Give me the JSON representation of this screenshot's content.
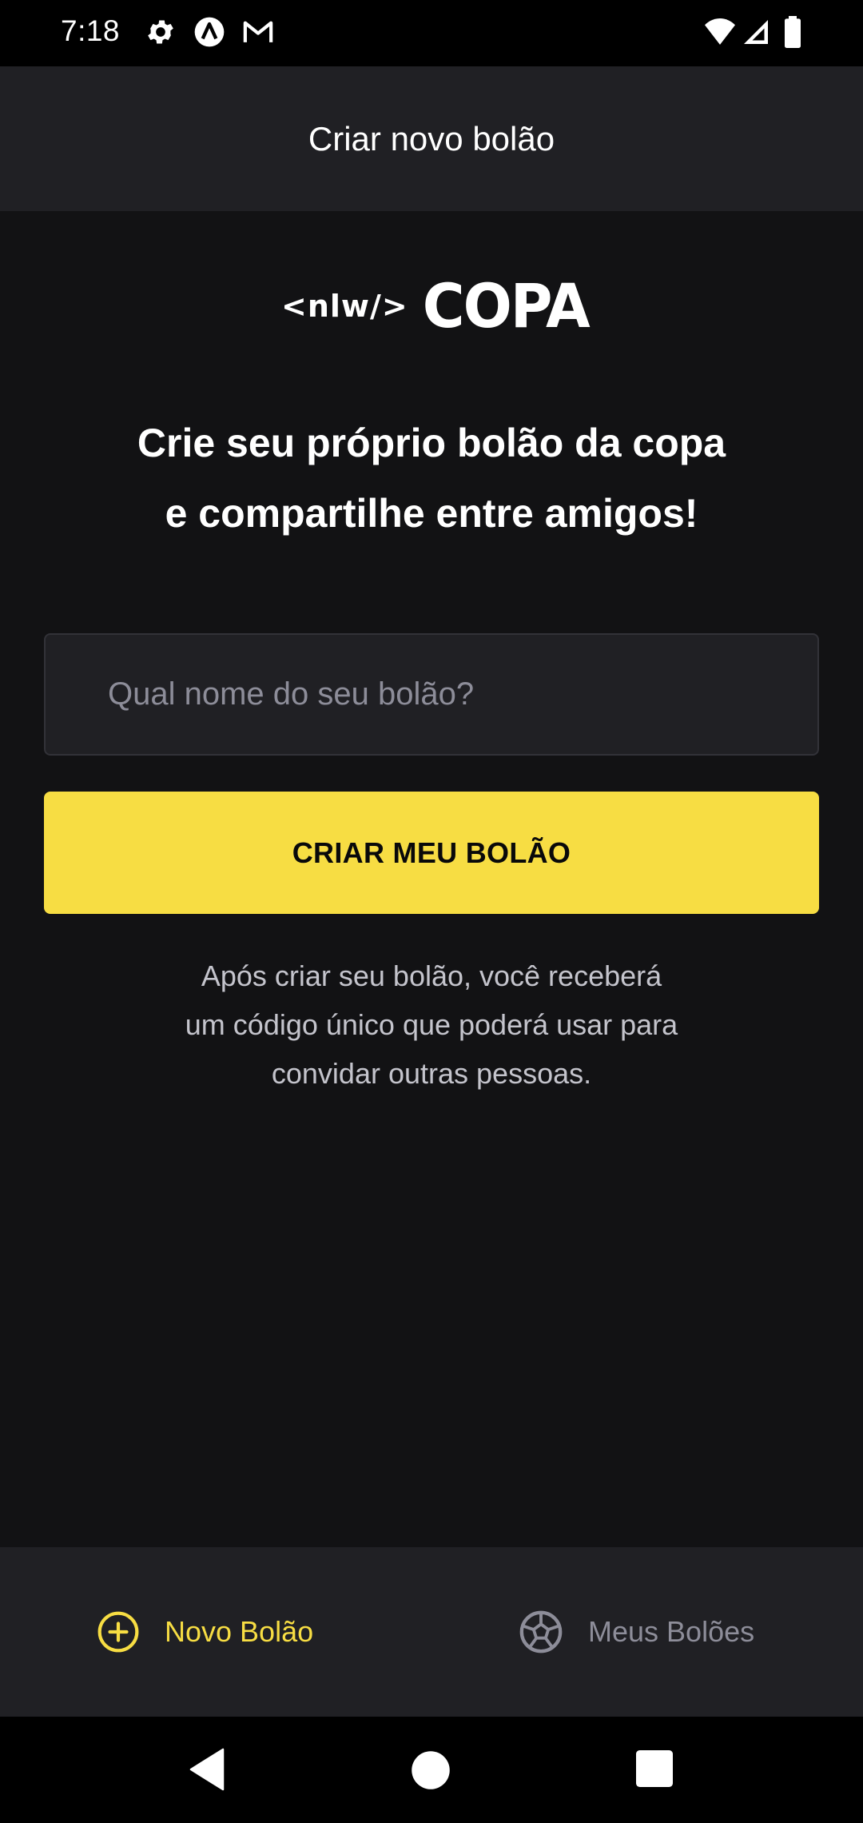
{
  "status_bar": {
    "time": "7:18",
    "left_icons": [
      "gear-icon",
      "a-circle-icon",
      "gmail-icon"
    ],
    "right_icons": [
      "wifi-icon",
      "signal-icon",
      "battery-icon"
    ]
  },
  "header": {
    "title": "Criar novo bolão"
  },
  "logo": {
    "code_text": "<nlw/>",
    "brand_text": "COPA"
  },
  "headline": {
    "line1": "Crie seu próprio bolão da copa",
    "line2": "e compartilhe entre amigos!"
  },
  "form": {
    "name_placeholder": "Qual nome do seu bolão?",
    "name_value": "",
    "submit_label": "CRIAR MEU BOLÃO"
  },
  "helper": {
    "line1": "Após criar seu bolão, você receberá",
    "line2": "um código único que poderá usar para",
    "line3": "convidar outras pessoas."
  },
  "tabs": [
    {
      "label": "Novo Bolão",
      "icon": "plus-circle-icon",
      "active": true
    },
    {
      "label": "Meus Bolões",
      "icon": "soccer-ball-icon",
      "active": false
    }
  ],
  "colors": {
    "background": "#121214",
    "surface": "#202024",
    "accent": "#f7dd43",
    "muted_text": "#c4c4cc",
    "inactive_tab": "#8d8d99"
  },
  "nav": [
    "back-icon",
    "home-icon",
    "recents-icon"
  ]
}
